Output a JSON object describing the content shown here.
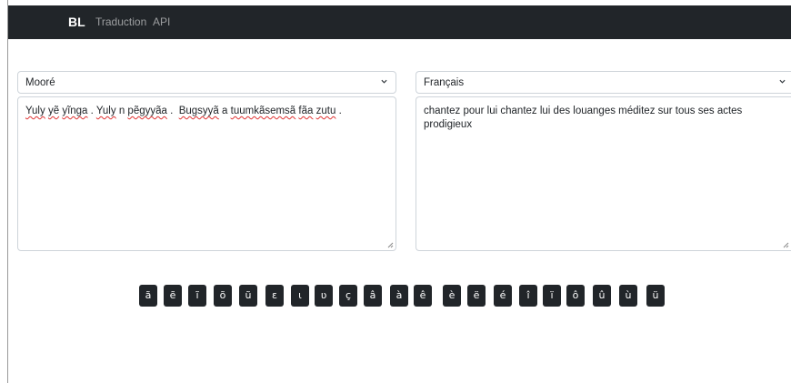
{
  "navbar": {
    "brand": "BL",
    "links": [
      "Traduction",
      "API"
    ]
  },
  "source": {
    "language": "Mooré",
    "text_words": [
      "Yuly",
      "yẽ",
      "yĩnga",
      ".",
      "Yuly",
      "n",
      "pẽgyyãa",
      ".",
      "",
      "Bugsyyã",
      "a",
      "tuumkãsemsã",
      "fãa",
      "zutu",
      "."
    ]
  },
  "target": {
    "language": "Français",
    "text": "chantez pour lui chantez lui des louanges méditez sur tous ses actes prodigieux"
  },
  "special_chars": [
    "ã",
    "ẽ",
    "ĩ",
    "õ",
    "ũ",
    "ɛ",
    "ɩ",
    "ʋ",
    "ç",
    "â",
    "à",
    "ê",
    "è",
    "ë",
    "é",
    "î",
    "ï",
    "ô",
    "û",
    "ù",
    "ü"
  ]
}
